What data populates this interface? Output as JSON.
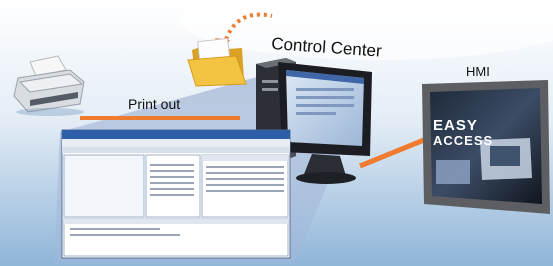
{
  "labels": {
    "control_center": "Control Center",
    "print_out": "Print out",
    "hmi": "HMI"
  },
  "hmi_screen": {
    "line1": "EASY",
    "line2": "ACCESS"
  },
  "colors": {
    "connection": "#f07a2e",
    "folder": "#f3c342",
    "background_top": "#ffffff",
    "background_bottom": "#8fb5d8"
  },
  "icons": [
    "printer-icon",
    "folder-icon",
    "computer-icon",
    "monitor-icon",
    "hmi-panel-icon",
    "sync-arrow-icon"
  ]
}
